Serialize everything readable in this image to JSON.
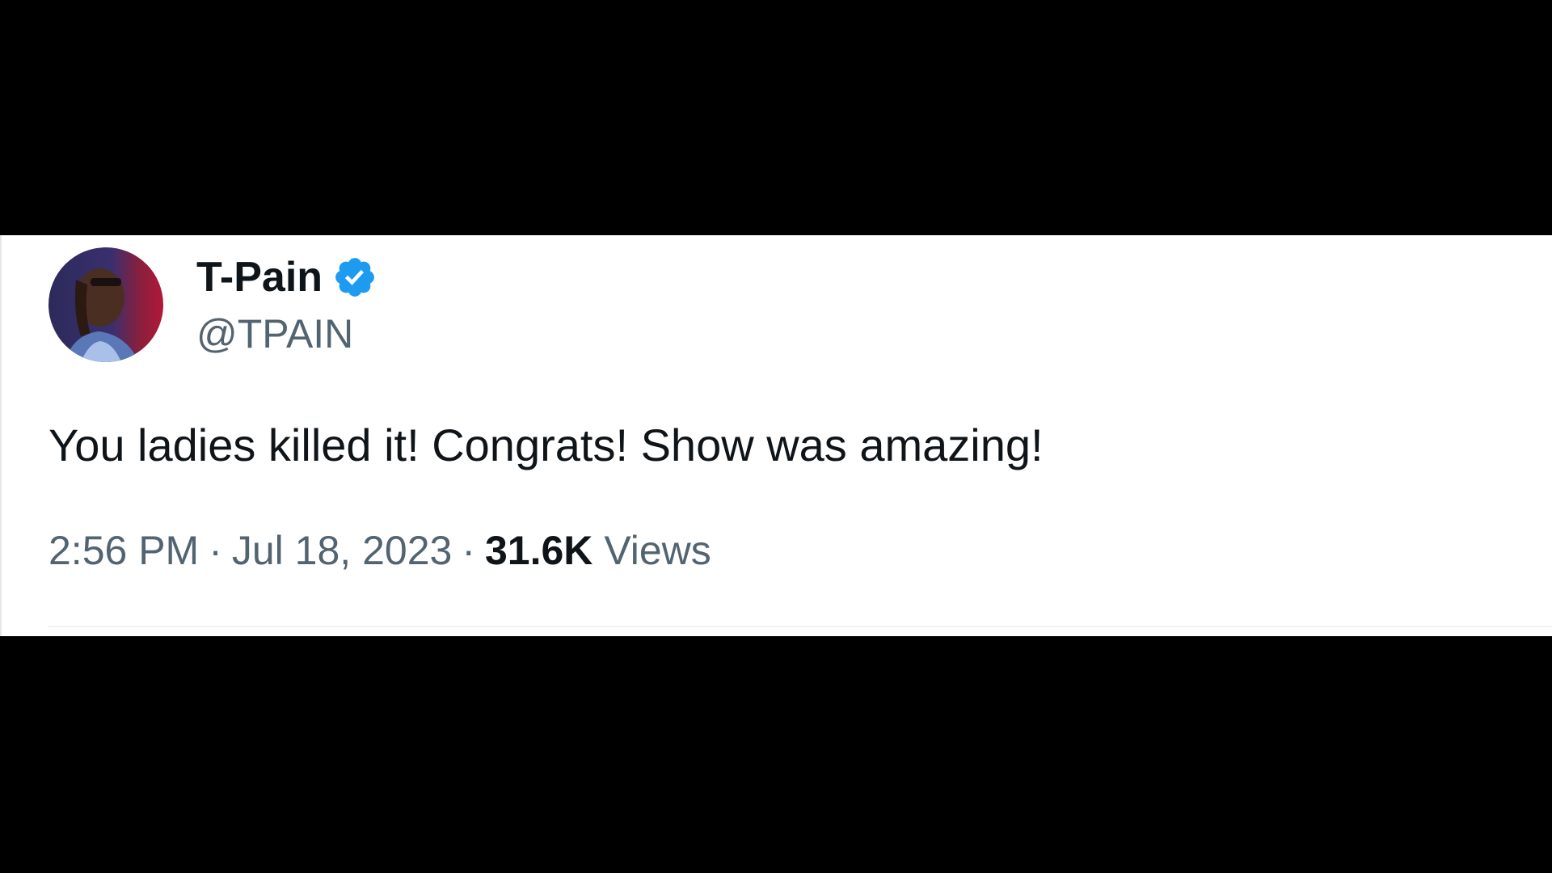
{
  "tweet": {
    "author": {
      "display_name": "T-Pain",
      "handle": "@TPAIN",
      "verified": true,
      "verified_icon": "verified-badge-icon",
      "verified_color": "#1d9bf0"
    },
    "text": "You ladies killed it! Congrats! Show was amazing!",
    "time": "2:56 PM",
    "date": "Jul 18, 2023",
    "separator": "·",
    "views_count": "31.6K",
    "views_label": "Views"
  },
  "colors": {
    "background": "#000000",
    "card": "#ffffff",
    "primary_text": "#0f1419",
    "secondary_text": "#536471"
  }
}
